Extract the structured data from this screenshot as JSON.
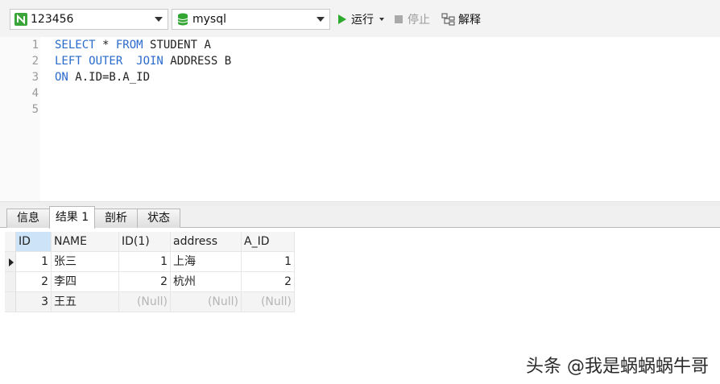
{
  "toolbar": {
    "connection": "123456",
    "database": "mysql",
    "run_label": "运行",
    "stop_label": "停止",
    "explain_label": "解释"
  },
  "editor": {
    "line_numbers": [
      "1",
      "2",
      "3",
      "4",
      "5"
    ],
    "lines": [
      [
        {
          "t": "SELECT",
          "k": true
        },
        {
          "t": " * ",
          "k": false
        },
        {
          "t": "FROM",
          "k": true
        },
        {
          "t": " STUDENT A",
          "k": false
        }
      ],
      [
        {
          "t": "LEFT OUTER  JOIN",
          "k": true
        },
        {
          "t": " ADDRESS B",
          "k": false
        }
      ],
      [
        {
          "t": "ON",
          "k": true
        },
        {
          "t": " A.ID=B.A_ID",
          "k": false
        }
      ],
      [],
      []
    ]
  },
  "tabs": [
    "信息",
    "结果 1",
    "剖析",
    "状态"
  ],
  "active_tab": 1,
  "table": {
    "columns": [
      "ID",
      "NAME",
      "ID(1)",
      "address",
      "A_ID"
    ],
    "rows": [
      [
        "1",
        "张三",
        "1",
        "上海",
        "1"
      ],
      [
        "2",
        "李四",
        "2",
        "杭州",
        "2"
      ],
      [
        "3",
        "王五",
        "(Null)",
        "(Null)",
        "(Null)"
      ]
    ]
  },
  "watermark": "头条 @我是蜗蜗蜗牛哥",
  "colors": {
    "keyword": "#2a6acb",
    "run_icon": "#2fa82f",
    "null_text": "#b5b5b5",
    "selected_header": "#cde3f7"
  }
}
